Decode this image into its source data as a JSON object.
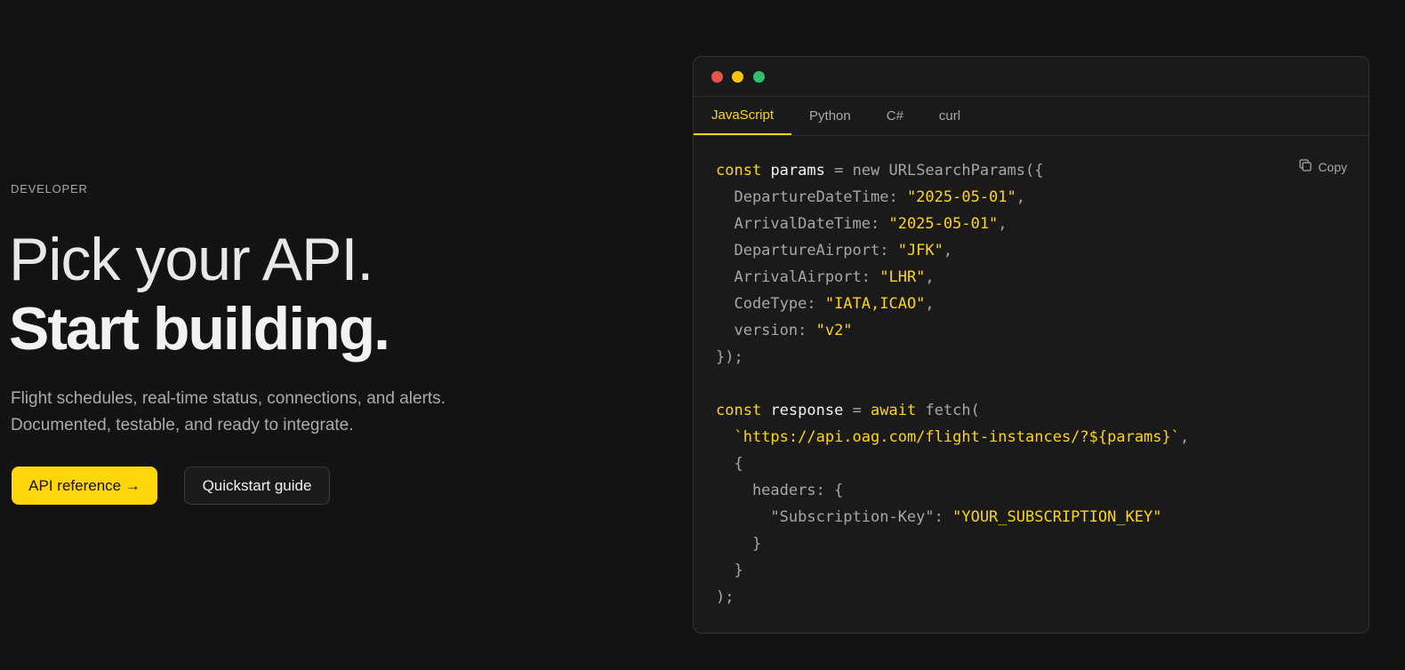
{
  "hero": {
    "eyebrow": "DEVELOPER",
    "headline_line1": "Pick your API.",
    "headline_line2": "Start building.",
    "subtext": "Flight schedules, real-time status, connections, and alerts. Documented, testable, and ready to integrate.",
    "primary_button": "API reference →",
    "secondary_button": "Quickstart guide"
  },
  "code_window": {
    "tabs": [
      {
        "label": "JavaScript",
        "active": true
      },
      {
        "label": "Python",
        "active": false
      },
      {
        "label": "C#",
        "active": false
      },
      {
        "label": "curl",
        "active": false
      }
    ],
    "copy_label": "Copy",
    "copy_icon": "copy-icon",
    "window_dots": [
      "#e5534b",
      "#f7c600",
      "#2bc26a"
    ],
    "code": {
      "l1": [
        "const",
        " ",
        "params",
        " = new URLSearchParams({"
      ],
      "l2": [
        "  DepartureDateTime: ",
        "\"2025-05-01\"",
        ","
      ],
      "l3": [
        "  ArrivalDateTime: ",
        "\"2025-05-01\"",
        ","
      ],
      "l4": [
        "  DepartureAirport: ",
        "\"JFK\"",
        ","
      ],
      "l5": [
        "  ArrivalAirport: ",
        "\"LHR\"",
        ","
      ],
      "l6": [
        "  CodeType: ",
        "\"IATA,ICAO\"",
        ","
      ],
      "l7": [
        "  version: ",
        "\"v2\""
      ],
      "l8": "});",
      "l10": [
        "const",
        " ",
        "response",
        " = ",
        "await",
        " fetch("
      ],
      "l11": [
        "  ",
        "`https://api.oag.com/flight-instances/?${params}`",
        ","
      ],
      "l12": "  {",
      "l13": "    headers: {",
      "l14": [
        "      \"Subscription-Key\": ",
        "\"YOUR_SUBSCRIPTION_KEY\""
      ],
      "l15": "    }",
      "l16": "  }",
      "l17": ");"
    }
  },
  "colors": {
    "accent": "#ffd60a",
    "background": "#131313",
    "panel": "#1a1a1a"
  }
}
